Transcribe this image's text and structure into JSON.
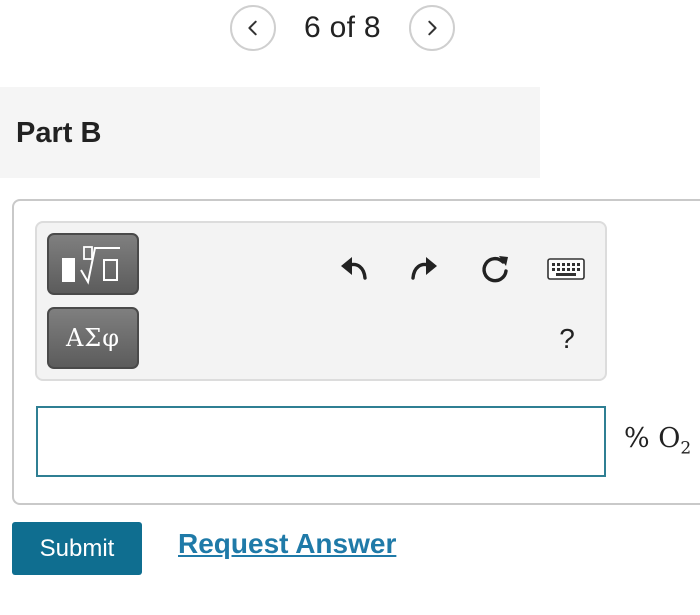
{
  "pagination": {
    "label": "6 of 8",
    "prev_icon": "chevron-left-icon",
    "next_icon": "chevron-right-icon"
  },
  "part": {
    "title": "Part B"
  },
  "toolbar": {
    "templates_icon": "templates-icon",
    "greek_label": "ΑΣφ",
    "undo_icon": "undo-icon",
    "redo_icon": "redo-icon",
    "reset_icon": "reset-icon",
    "keyboard_icon": "keyboard-icon",
    "help_label": "?"
  },
  "answer": {
    "value": "",
    "unit_prefix": "% O",
    "unit_subscript": "2"
  },
  "actions": {
    "submit_label": "Submit",
    "request_answer_label": "Request Answer"
  },
  "colors": {
    "accent": "#0f6e90",
    "link": "#1f7aa8",
    "input_border": "#2f7f93",
    "toolbar_button": "#6b6b6b"
  }
}
